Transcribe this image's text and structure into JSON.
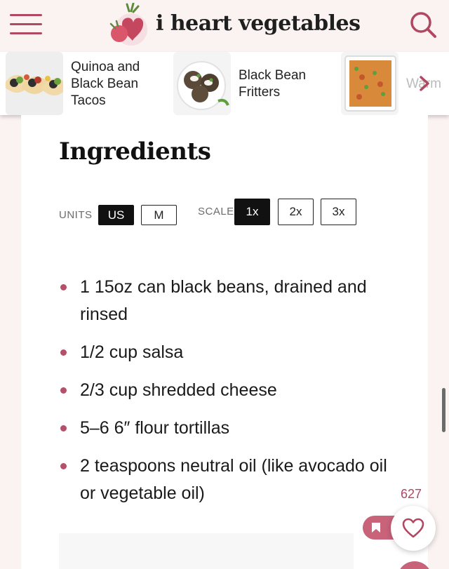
{
  "header": {
    "logo_text": "i heart vegetables",
    "menu_icon": "hamburger-icon",
    "search_icon": "search-icon",
    "brand_color": "#b04862"
  },
  "carousel": {
    "cards": [
      {
        "title": "Quinoa and Black Bean Tacos"
      },
      {
        "title": "Black Bean Fritters"
      },
      {
        "title": "Warm"
      }
    ],
    "next_icon": "chevron-right-icon"
  },
  "recipe": {
    "heading": "Ingredients",
    "units_label": "UNITS",
    "units_options": [
      "US",
      "M"
    ],
    "units_selected": "US",
    "scale_label": "SCALE",
    "scale_options": [
      "1x",
      "2x",
      "3x"
    ],
    "scale_selected": "1x",
    "ingredients": [
      "1 15oz can black beans, drained and rinsed",
      "1/2 cup salsa",
      "2/3 cup shredded cheese",
      "5–6 6″ flour tortillas",
      "2 teaspoons neutral oil (like avocado oil or vegetable oil)"
    ],
    "bullet_color": "#b5506a"
  },
  "floating": {
    "favorite_count": "627",
    "heart_icon": "heart-icon",
    "bookmark_icon": "bookmark-icon"
  }
}
